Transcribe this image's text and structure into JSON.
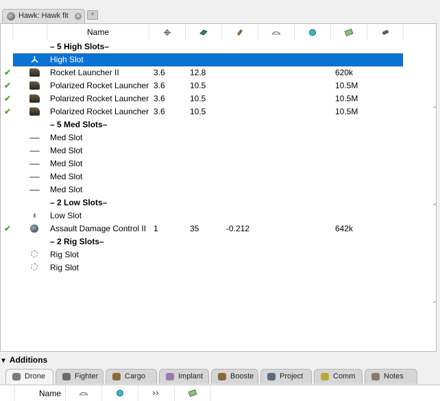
{
  "window": {
    "tab_title": "Hawk: Hawk fit",
    "tab_icon": "ship-icon",
    "close_icon": "close-icon",
    "new_tab_icon": "new-tab-icon"
  },
  "columns": {
    "name": "Name",
    "icons": [
      "cpu-icon",
      "powergrid-icon",
      "capacitor-icon",
      "range-icon",
      "optimal-icon",
      "price-icon",
      "ammo-icon"
    ]
  },
  "rows": [
    {
      "type": "header",
      "label": "– 5 High Slots–"
    },
    {
      "type": "slot",
      "selected": true,
      "icon": "high-slot-icon",
      "name": "High Slot",
      "cpu": "",
      "pg": "",
      "cap": "",
      "price": ""
    },
    {
      "type": "module",
      "checked": true,
      "icon": "rocket-launcher-icon",
      "name": "Rocket Launcher II",
      "cpu": "3.6",
      "pg": "12.8",
      "cap": "",
      "price": "620k"
    },
    {
      "type": "module",
      "checked": true,
      "icon": "rocket-launcher-icon",
      "name": "Polarized Rocket Launcher",
      "cpu": "3.6",
      "pg": "10.5",
      "cap": "",
      "price": "10.5M"
    },
    {
      "type": "module",
      "checked": true,
      "icon": "rocket-launcher-icon",
      "name": "Polarized Rocket Launcher",
      "cpu": "3.6",
      "pg": "10.5",
      "cap": "",
      "price": "10.5M"
    },
    {
      "type": "module",
      "checked": true,
      "icon": "rocket-launcher-icon",
      "name": "Polarized Rocket Launcher",
      "cpu": "3.6",
      "pg": "10.5",
      "cap": "",
      "price": "10.5M"
    },
    {
      "type": "header",
      "label": "– 5 Med Slots–"
    },
    {
      "type": "slot",
      "icon": "med-slot-icon",
      "name": "Med Slot",
      "cpu": "",
      "pg": "",
      "cap": "",
      "price": ""
    },
    {
      "type": "slot",
      "icon": "med-slot-icon",
      "name": "Med Slot",
      "cpu": "",
      "pg": "",
      "cap": "",
      "price": ""
    },
    {
      "type": "slot",
      "icon": "med-slot-icon",
      "name": "Med Slot",
      "cpu": "",
      "pg": "",
      "cap": "",
      "price": ""
    },
    {
      "type": "slot",
      "icon": "med-slot-icon",
      "name": "Med Slot",
      "cpu": "",
      "pg": "",
      "cap": "",
      "price": ""
    },
    {
      "type": "slot",
      "icon": "med-slot-icon",
      "name": "Med Slot",
      "cpu": "",
      "pg": "",
      "cap": "",
      "price": ""
    },
    {
      "type": "header",
      "label": "– 2 Low Slots–"
    },
    {
      "type": "slot",
      "icon": "low-slot-icon",
      "name": "Low Slot",
      "cpu": "",
      "pg": "",
      "cap": "",
      "price": ""
    },
    {
      "type": "module",
      "checked": true,
      "icon": "damage-control-icon",
      "name": "Assault Damage Control II",
      "cpu": "1",
      "pg": "35",
      "cap": "-0.212",
      "price": "642k"
    },
    {
      "type": "header",
      "label": "– 2 Rig Slots–"
    },
    {
      "type": "slot",
      "icon": "rig-slot-icon",
      "name": "Rig Slot",
      "cpu": "",
      "pg": "",
      "cap": "",
      "price": ""
    },
    {
      "type": "slot",
      "icon": "rig-slot-icon",
      "name": "Rig Slot",
      "cpu": "",
      "pg": "",
      "cap": "",
      "price": ""
    }
  ],
  "additions": {
    "title": "Additions",
    "tabs": [
      {
        "label": "Drone",
        "icon": "drone-icon",
        "active": true
      },
      {
        "label": "Fighter",
        "icon": "fighter-icon"
      },
      {
        "label": "Cargo",
        "icon": "cargo-icon"
      },
      {
        "label": "Implant",
        "icon": "implant-icon"
      },
      {
        "label": "Booste",
        "icon": "booster-icon"
      },
      {
        "label": "Project",
        "icon": "projected-icon"
      },
      {
        "label": "Comm",
        "icon": "command-icon"
      },
      {
        "label": "Notes",
        "icon": "notes-icon"
      }
    ],
    "columns": {
      "name": "Name",
      "icons": [
        "range-icon",
        "optimal-icon",
        "speed-icon",
        "price-icon"
      ]
    }
  }
}
